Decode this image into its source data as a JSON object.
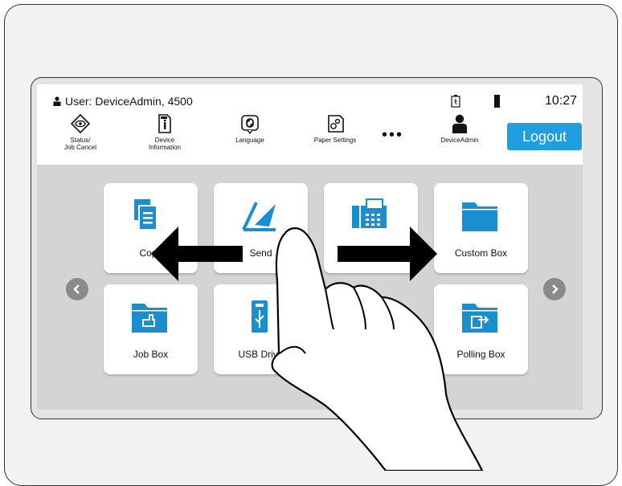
{
  "header": {
    "user_text": "User: DeviceAdmin, 4500",
    "time": "10:27"
  },
  "toolbar": {
    "items": [
      {
        "label": "Status/\nJob Cancel",
        "icon": "eye-icon"
      },
      {
        "label": "Device\nInformation",
        "icon": "device-info-icon"
      },
      {
        "label": "Language",
        "icon": "language-icon"
      },
      {
        "label": "Paper Settings",
        "icon": "paper-settings-icon"
      },
      {
        "label": "DeviceAdmin",
        "icon": "user-icon"
      }
    ],
    "more": "•••",
    "logout_label": "Logout"
  },
  "tiles": [
    {
      "label": "Copy",
      "icon": "copy-icon"
    },
    {
      "label": "Send",
      "icon": "send-icon"
    },
    {
      "label": "Fax",
      "icon": "fax-icon"
    },
    {
      "label": "Custom Box",
      "icon": "folder-icon"
    },
    {
      "label": "Job Box",
      "icon": "job-box-icon"
    },
    {
      "label": "USB Drive",
      "icon": "usb-icon"
    },
    {
      "label": "Polling Box",
      "icon": "polling-box-icon"
    }
  ],
  "colors": {
    "accent": "#1f9fe0",
    "tile_icon": "#1a8fd0"
  }
}
